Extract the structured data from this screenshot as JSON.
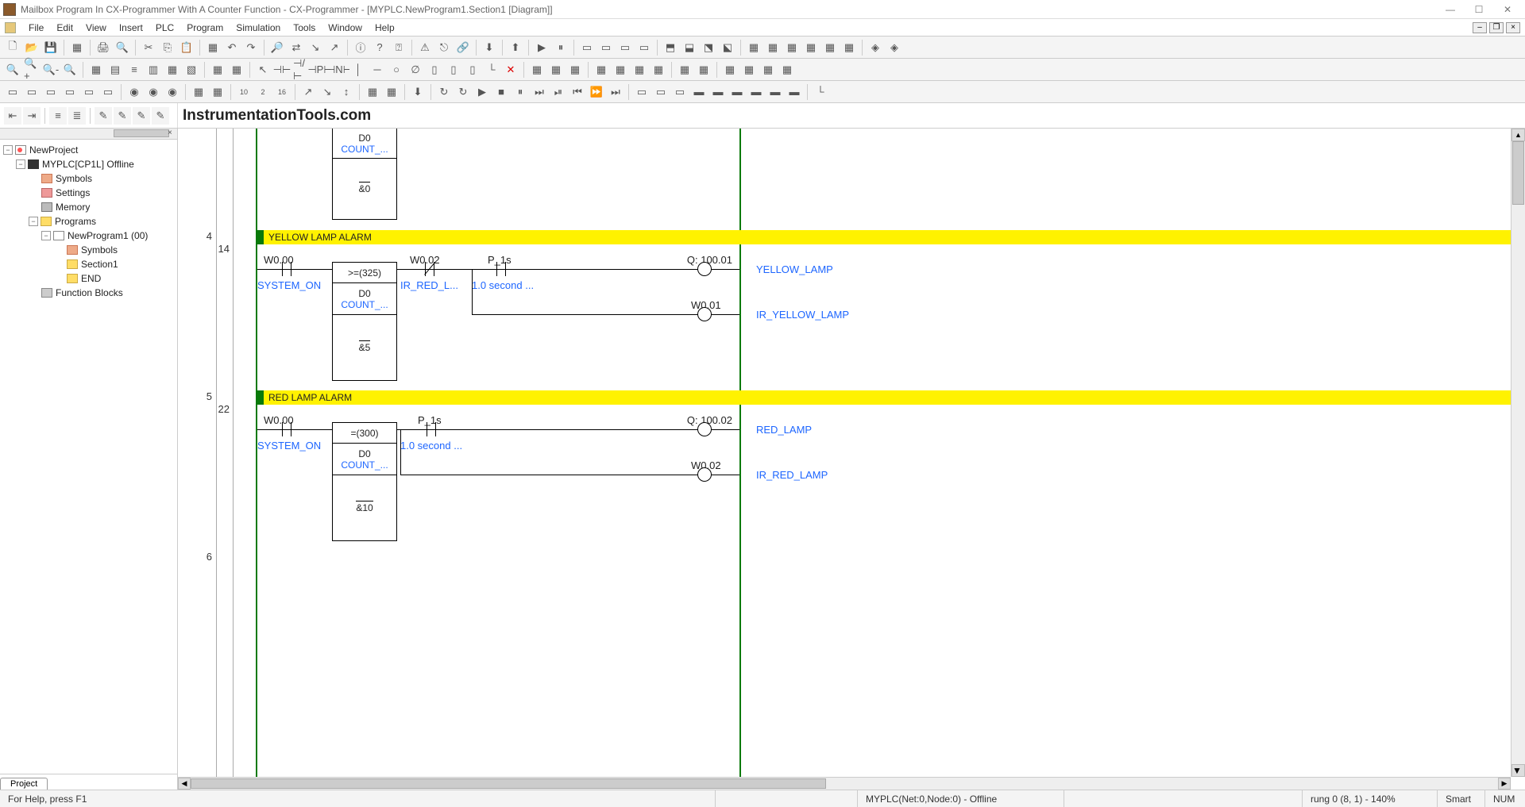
{
  "title_bar": {
    "text": "Mailbox Program In CX-Programmer With A Counter Function - CX-Programmer - [MYPLC.NewProgram1.Section1 [Diagram]]"
  },
  "menu": {
    "file": "File",
    "edit": "Edit",
    "view": "View",
    "insert": "Insert",
    "plc": "PLC",
    "program": "Program",
    "simulation": "Simulation",
    "tools": "Tools",
    "window": "Window",
    "help": "Help"
  },
  "watermark": "InstrumentationTools.com",
  "tree": {
    "project": "NewProject",
    "plc": "MYPLC[CP1L] Offline",
    "symbols": "Symbols",
    "settings": "Settings",
    "memory": "Memory",
    "programs": "Programs",
    "newprogram": "NewProgram1 (00)",
    "np_symbols": "Symbols",
    "section1": "Section1",
    "end": "END",
    "fb": "Function Blocks",
    "tab": "Project"
  },
  "rung_top": {
    "block_d0": "D0",
    "block_count": "COUNT_...",
    "block_val": "&0"
  },
  "rung4": {
    "left_num": "4",
    "step_num": "14",
    "title": "YELLOW LAMP ALARM",
    "c1_addr": "W0.00",
    "c1_lbl": "SYSTEM_ON",
    "block_op": ">=(325)",
    "block_d0": "D0",
    "block_count": "COUNT_...",
    "block_val": "&5",
    "c2_addr": "W0.02",
    "c2_lbl": "IR_RED_L...",
    "c3_addr": "P_1s",
    "c3_lbl": "1.0 second ...",
    "out1_addr": "Q: 100.01",
    "out1_lbl": "YELLOW_LAMP",
    "out2_addr": "W0.01",
    "out2_lbl": "IR_YELLOW_LAMP"
  },
  "rung5": {
    "left_num": "5",
    "step_num": "22",
    "title": "RED LAMP ALARM",
    "c1_addr": "W0.00",
    "c1_lbl": "SYSTEM_ON",
    "block_op": "=(300)",
    "block_d0": "D0",
    "block_count": "COUNT_...",
    "block_val": "&10",
    "c2_addr": "P_1s",
    "c2_lbl": "1.0 second ...",
    "out1_addr": "Q: 100.02",
    "out1_lbl": "RED_LAMP",
    "out2_addr": "W0.02",
    "out2_lbl": "IR_RED_LAMP"
  },
  "rung6": {
    "left_num": "6"
  },
  "status": {
    "help": "For Help, press F1",
    "plc": "MYPLC(Net:0,Node:0) - Offline",
    "rung": "rung 0 (8, 1)  - 140%",
    "smart": "Smart",
    "num": "NUM"
  }
}
